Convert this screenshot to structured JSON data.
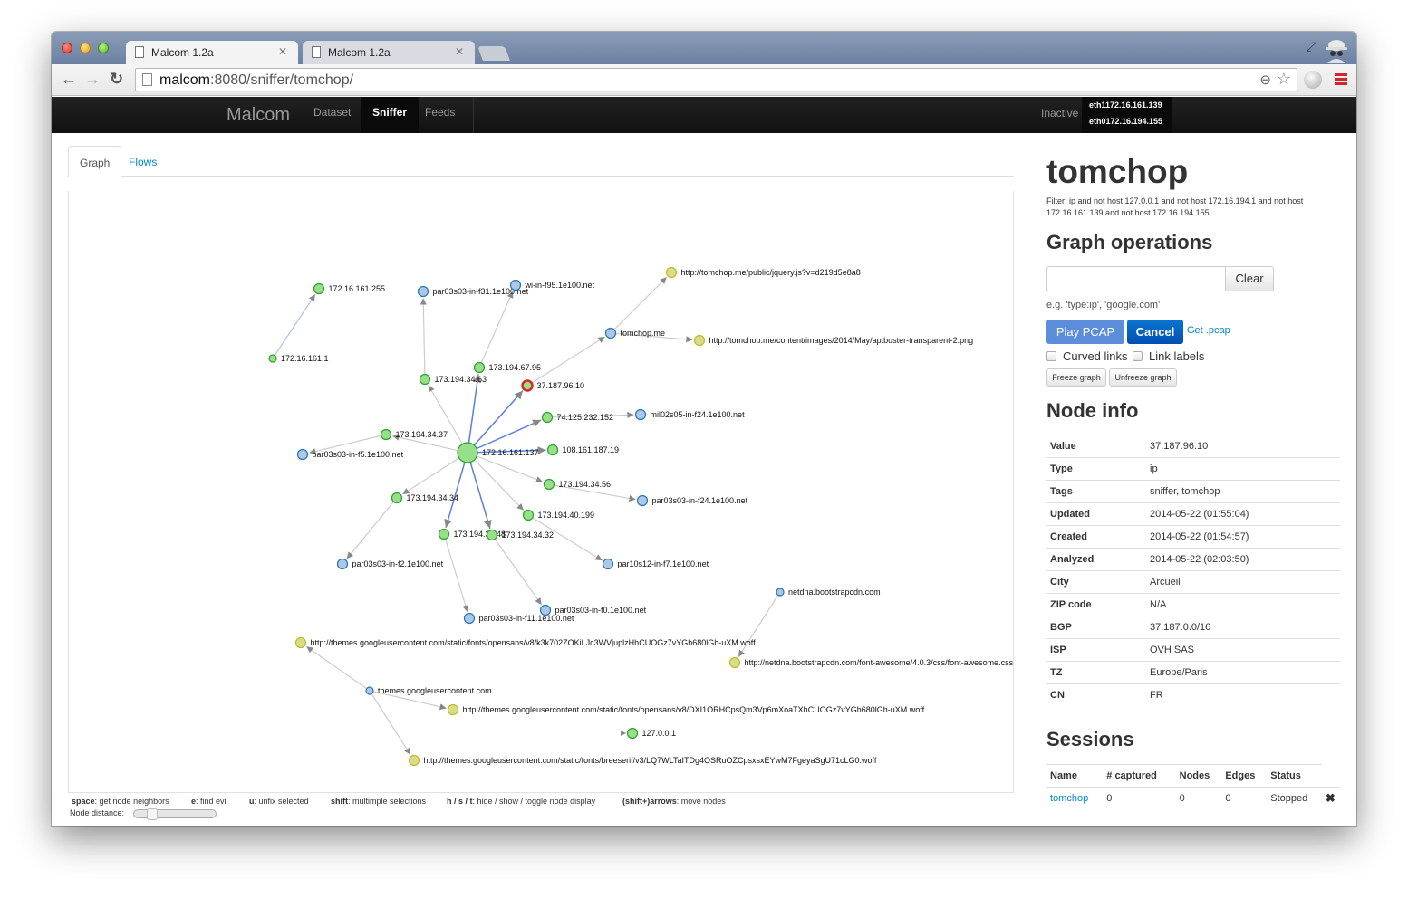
{
  "browser": {
    "tabs": [
      {
        "title": "Malcom 1.2a",
        "active": true
      },
      {
        "title": "Malcom 1.2a",
        "active": false
      }
    ],
    "url_host": "malcom",
    "url_rest": ":8080/sniffer/tomchop/"
  },
  "navbar": {
    "brand": "Malcom",
    "links": [
      {
        "label": "Dataset",
        "active": false
      },
      {
        "label": "Sniffer",
        "active": true
      },
      {
        "label": "Feeds",
        "active": false
      }
    ],
    "status": "Inactive",
    "interfaces": [
      "eth1172.16.161.139",
      "eth0172.16.194.155"
    ]
  },
  "content_tabs": [
    {
      "label": "Graph",
      "active": true
    },
    {
      "label": "Flows",
      "active": false
    }
  ],
  "graph": {
    "colors": {
      "ip": "#98df8a",
      "ip_stroke": "#2ca02c",
      "hostname": "#aec7e8",
      "hostname_stroke": "#1f77b4",
      "url": "#dbdb8d",
      "url_stroke": "#bcbd22",
      "selected_stroke": "#d62728",
      "link": "#cccccc",
      "link_active": "#5b7fde",
      "link_light": "#a9c4ea"
    },
    "nodes": [
      {
        "id": "172.16.161.255",
        "type": "ip"
      },
      {
        "id": "172.16.161.1",
        "type": "ip",
        "small": true
      },
      {
        "id": "par03s03-in-f31.1e100.net",
        "type": "hostname"
      },
      {
        "id": "wi-in-f95.1e100.net",
        "type": "hostname"
      },
      {
        "id": "http://tomchop.me/public/jquery.js?v=d219d5e8a8",
        "type": "url"
      },
      {
        "id": "tomchop.me",
        "type": "hostname"
      },
      {
        "id": "http://tomchop.me/content/images/2014/May/aptbuster-transparent-2.png",
        "type": "url"
      },
      {
        "id": "173.194.67.95",
        "type": "ip"
      },
      {
        "id": "173.194.34.63",
        "type": "ip"
      },
      {
        "id": "37.187.96.10",
        "type": "ip",
        "selected": true
      },
      {
        "id": "74.125.232.152",
        "type": "ip"
      },
      {
        "id": "mil02s05-in-f24.1e100.net",
        "type": "hostname"
      },
      {
        "id": "173.194.34.37",
        "type": "ip"
      },
      {
        "id": "par03s03-in-f5.1e100.net",
        "type": "hostname"
      },
      {
        "id": "172.16.161.137",
        "type": "ip",
        "center": true
      },
      {
        "id": "108.161.187.19",
        "type": "ip"
      },
      {
        "id": "173.194.34.56",
        "type": "ip"
      },
      {
        "id": "par03s03-in-f24.1e100.net",
        "type": "hostname"
      },
      {
        "id": "173.194.34.34",
        "type": "ip"
      },
      {
        "id": "173.194.40.199",
        "type": "ip"
      },
      {
        "id": "173.194.34.48",
        "type": "ip"
      },
      {
        "id": "173.194.34.32",
        "type": "ip"
      },
      {
        "id": "par03s03-in-f2.1e100.net",
        "type": "hostname"
      },
      {
        "id": "par10s12-in-f7.1e100.net",
        "type": "hostname"
      },
      {
        "id": "par03s03-in-f0.1e100.net",
        "type": "hostname"
      },
      {
        "id": "par03s03-in-f11.1e100.net",
        "type": "hostname"
      },
      {
        "id": "netdna.bootstrapcdn.com",
        "type": "hostname",
        "small": true
      },
      {
        "id": "http://themes.googleusercontent.com/static/fonts/opensans/v8/k3k702ZOKiLJc3WVjuplzHhCUOGz7vYGh680lGh-uXM.woff",
        "type": "url"
      },
      {
        "id": "http://netdna.bootstrapcdn.com/font-awesome/4.0.3/css/font-awesome.css",
        "type": "url"
      },
      {
        "id": "themes.googleusercontent.com",
        "type": "hostname",
        "small": true
      },
      {
        "id": "http://themes.googleusercontent.com/static/fonts/opensans/v8/DXI1ORHCpsQm3Vp6mXoaTXhCUOGz7vYGh680lGh-uXM.woff",
        "type": "url"
      },
      {
        "id": "127.0.0.1",
        "type": "ip"
      },
      {
        "id": "http://themes.googleusercontent.com/static/fonts/breeserif/v3/LQ7WLTaITDg4OSRuOZCpsxsxEYwM7FgeyaSgU71cLG0.woff",
        "type": "url"
      }
    ],
    "links": [
      {
        "source": "172.16.161.1",
        "target": "172.16.161.255",
        "style": "light"
      },
      {
        "source": "172.16.161.137",
        "target": "173.194.34.63"
      },
      {
        "source": "172.16.161.137",
        "target": "173.194.67.95",
        "style": "active"
      },
      {
        "source": "172.16.161.137",
        "target": "37.187.96.10",
        "style": "active"
      },
      {
        "source": "172.16.161.137",
        "target": "74.125.232.152",
        "style": "active"
      },
      {
        "source": "172.16.161.137",
        "target": "108.161.187.19",
        "style": "active"
      },
      {
        "source": "172.16.161.137",
        "target": "173.194.34.56"
      },
      {
        "source": "172.16.161.137",
        "target": "173.194.40.199"
      },
      {
        "source": "172.16.161.137",
        "target": "173.194.34.32",
        "style": "active"
      },
      {
        "source": "172.16.161.137",
        "target": "173.194.34.48",
        "style": "active"
      },
      {
        "source": "172.16.161.137",
        "target": "173.194.34.34"
      },
      {
        "source": "172.16.161.137",
        "target": "173.194.34.37"
      },
      {
        "source": "173.194.34.63",
        "target": "par03s03-in-f31.1e100.net"
      },
      {
        "source": "173.194.67.95",
        "target": "wi-in-f95.1e100.net"
      },
      {
        "source": "37.187.96.10",
        "target": "tomchop.me"
      },
      {
        "source": "tomchop.me",
        "target": "http://tomchop.me/public/jquery.js?v=d219d5e8a8"
      },
      {
        "source": "tomchop.me",
        "target": "http://tomchop.me/content/images/2014/May/aptbuster-transparent-2.png"
      },
      {
        "source": "74.125.232.152",
        "target": "mil02s05-in-f24.1e100.net"
      },
      {
        "source": "173.194.34.37",
        "target": "par03s03-in-f5.1e100.net"
      },
      {
        "source": "173.194.34.56",
        "target": "par03s03-in-f24.1e100.net"
      },
      {
        "source": "173.194.34.34",
        "target": "par03s03-in-f2.1e100.net"
      },
      {
        "source": "173.194.40.199",
        "target": "par10s12-in-f7.1e100.net"
      },
      {
        "source": "173.194.34.32",
        "target": "par03s03-in-f0.1e100.net"
      },
      {
        "source": "173.194.34.48",
        "target": "par03s03-in-f11.1e100.net"
      },
      {
        "source": "netdna.bootstrapcdn.com",
        "target": "http://netdna.bootstrapcdn.com/font-awesome/4.0.3/css/font-awesome.css"
      },
      {
        "source": "themes.googleusercontent.com",
        "target": "http://themes.googleusercontent.com/static/fonts/opensans/v8/k3k702ZOKiLJc3WVjuplzHhCUOGz7vYGh680lGh-uXM.woff"
      },
      {
        "source": "themes.googleusercontent.com",
        "target": "http://themes.googleusercontent.com/static/fonts/opensans/v8/DXI1ORHCpsQm3Vp6mXoaTXhCUOGz7vYGh680lGh-uXM.woff"
      },
      {
        "source": "themes.googleusercontent.com",
        "target": "http://themes.googleusercontent.com/static/fonts/breeserif/v3/LQ7WLTaITDg4OSRuOZCpsxsxEYwM7FgeyaSgU71cLG0.woff"
      }
    ]
  },
  "hints": [
    {
      "key": "space",
      "text": ": get node neighbors"
    },
    {
      "key": "e",
      "text": ": find evil"
    },
    {
      "key": "u",
      "text": ": unfix selected"
    },
    {
      "key": "shift",
      "text": ": multimple selections"
    },
    {
      "key": "h / s / t",
      "text": ": hide / show / toggle node display"
    },
    {
      "key": "(shift+)arrows",
      "text": ": move nodes"
    }
  ],
  "node_distance": {
    "label": "Node distance:",
    "value_fraction": 0.2
  },
  "sidebar": {
    "title": "tomchop",
    "filter": "Filter: ip and not host 127.0.0.1 and not host 172.16.194.1 and not host 172.16.161.139 and not host 172.16.194.155",
    "graph_ops_heading": "Graph operations",
    "search_value": "",
    "clear_label": "Clear",
    "example": "e.g. 'type:ip', 'google.com'",
    "play_label": "Play PCAP",
    "cancel_label": "Cancel",
    "getpcap_label": "Get .pcap",
    "curved_links_label": "Curved links",
    "curved_links_checked": false,
    "link_labels_label": "Link labels",
    "link_labels_checked": false,
    "freeze_label": "Freeze graph",
    "unfreeze_label": "Unfreeze graph",
    "node_info_heading": "Node info",
    "node_info": [
      {
        "key": "Value",
        "value": "37.187.96.10"
      },
      {
        "key": "Type",
        "value": "ip"
      },
      {
        "key": "Tags",
        "value": "sniffer, tomchop"
      },
      {
        "key": "Updated",
        "value": "2014-05-22 (01:55:04)"
      },
      {
        "key": "Created",
        "value": "2014-05-22 (01:54:57)"
      },
      {
        "key": "Analyzed",
        "value": "2014-05-22 (02:03:50)"
      },
      {
        "key": "City",
        "value": "Arcueil"
      },
      {
        "key": "ZIP code",
        "value": "N/A"
      },
      {
        "key": "BGP",
        "value": "37.187.0.0/16"
      },
      {
        "key": "ISP",
        "value": "OVH SAS"
      },
      {
        "key": "TZ",
        "value": "Europe/Paris"
      },
      {
        "key": "CN",
        "value": "FR"
      }
    ],
    "sessions_heading": "Sessions",
    "sessions_columns": [
      "Name",
      "# captured",
      "Nodes",
      "Edges",
      "Status"
    ],
    "sessions": [
      {
        "name": "tomchop",
        "captured": "0",
        "nodes": "0",
        "edges": "0",
        "status": "Stopped"
      }
    ]
  }
}
